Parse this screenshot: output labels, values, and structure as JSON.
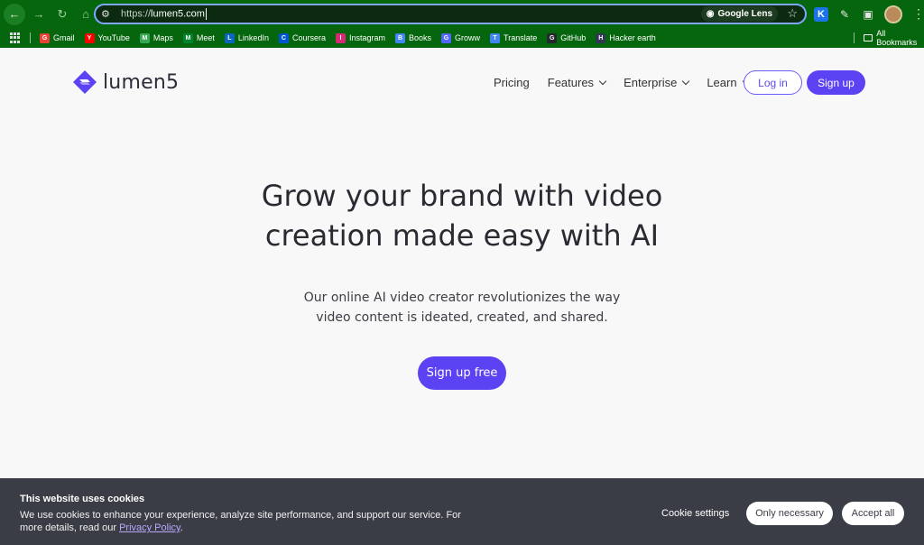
{
  "browser": {
    "url_scheme": "https://",
    "url_host": "lumen5.com",
    "lens_label": "Google Lens",
    "all_bookmarks_label": "All Bookmarks",
    "bookmarks": [
      {
        "label": "Gmail",
        "icon": "gmail-icon",
        "color": "#ea4335"
      },
      {
        "label": "YouTube",
        "icon": "youtube-icon",
        "color": "#ff0000"
      },
      {
        "label": "Maps",
        "icon": "maps-icon",
        "color": "#34a853"
      },
      {
        "label": "Meet",
        "icon": "meet-icon",
        "color": "#00832d"
      },
      {
        "label": "LinkedIn",
        "icon": "linkedin-icon",
        "color": "#0a66c2"
      },
      {
        "label": "Coursera",
        "icon": "coursera-icon",
        "color": "#0056d2"
      },
      {
        "label": "Instagram",
        "icon": "instagram-icon",
        "color": "#d62976"
      },
      {
        "label": "Books",
        "icon": "google-books-icon",
        "color": "#4285f4"
      },
      {
        "label": "Groww",
        "icon": "groww-icon",
        "color": "#5367ff"
      },
      {
        "label": "Translate",
        "icon": "translate-icon",
        "color": "#4285f4"
      },
      {
        "label": "GitHub",
        "icon": "github-icon",
        "color": "#24292e"
      },
      {
        "label": "Hacker earth",
        "icon": "hackerearth-icon",
        "color": "#323754"
      }
    ]
  },
  "site": {
    "logo_text": "lumen5",
    "brand_color": "#5b42f3",
    "nav": {
      "pricing": "Pricing",
      "features": "Features",
      "enterprise": "Enterprise",
      "learn": "Learn",
      "login": "Log in",
      "signup": "Sign up"
    },
    "hero": {
      "title_line1": "Grow your brand with video",
      "title_line2": "creation made easy with AI",
      "sub_line1": "Our online AI video creator revolutionizes the way",
      "sub_line2": "video content is ideated, created, and shared.",
      "cta": "Sign up free"
    }
  },
  "cookie": {
    "title": "This website uses cookies",
    "text_line1": "We use cookies to enhance your experience, analyze site performance, and support our service. For",
    "text_line2_pre": "more details, read our ",
    "privacy_link": "Privacy Policy",
    "text_line2_post": ".",
    "settings": "Cookie settings",
    "only_necessary": "Only necessary",
    "accept_all": "Accept all"
  }
}
